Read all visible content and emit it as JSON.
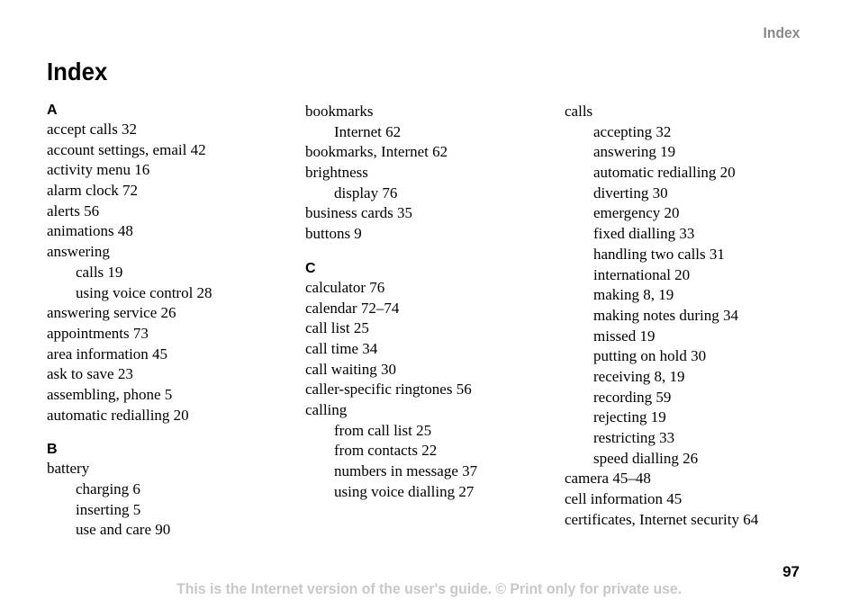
{
  "header": {
    "running_head": "Index",
    "title": "Index"
  },
  "columns": [
    {
      "blocks": [
        {
          "letter": "A",
          "entries": [
            {
              "text": "accept calls 32",
              "level": 0
            },
            {
              "text": "account settings, email 42",
              "level": 0
            },
            {
              "text": "activity menu 16",
              "level": 0
            },
            {
              "text": "alarm clock 72",
              "level": 0
            },
            {
              "text": "alerts 56",
              "level": 0
            },
            {
              "text": "animations 48",
              "level": 0
            },
            {
              "text": "answering",
              "level": 0
            },
            {
              "text": "calls 19",
              "level": 1
            },
            {
              "text": "using voice control 28",
              "level": 1
            },
            {
              "text": "answering service 26",
              "level": 0
            },
            {
              "text": "appointments 73",
              "level": 0
            },
            {
              "text": "area information 45",
              "level": 0
            },
            {
              "text": "ask to save 23",
              "level": 0
            },
            {
              "text": "assembling, phone 5",
              "level": 0
            },
            {
              "text": "automatic redialling 20",
              "level": 0
            }
          ]
        },
        {
          "letter": "B",
          "entries": [
            {
              "text": "battery",
              "level": 0
            },
            {
              "text": "charging 6",
              "level": 1
            },
            {
              "text": "inserting 5",
              "level": 1
            },
            {
              "text": "use and care 90",
              "level": 1
            }
          ]
        }
      ]
    },
    {
      "blocks": [
        {
          "letter": "",
          "entries": [
            {
              "text": "bookmarks",
              "level": 0
            },
            {
              "text": "Internet 62",
              "level": 1
            },
            {
              "text": "bookmarks, Internet 62",
              "level": 0
            },
            {
              "text": "brightness",
              "level": 0
            },
            {
              "text": "display 76",
              "level": 1
            },
            {
              "text": "business cards 35",
              "level": 0
            },
            {
              "text": "buttons 9",
              "level": 0
            }
          ]
        },
        {
          "letter": "C",
          "entries": [
            {
              "text": "calculator 76",
              "level": 0
            },
            {
              "text": "calendar 72–74",
              "level": 0
            },
            {
              "text": "call list 25",
              "level": 0
            },
            {
              "text": "call time 34",
              "level": 0
            },
            {
              "text": "call waiting 30",
              "level": 0
            },
            {
              "text": "caller-specific ringtones 56",
              "level": 0
            },
            {
              "text": "calling",
              "level": 0
            },
            {
              "text": "from call list 25",
              "level": 1
            },
            {
              "text": "from contacts 22",
              "level": 1
            },
            {
              "text": "numbers in message 37",
              "level": 1
            },
            {
              "text": "using voice dialling 27",
              "level": 1
            }
          ]
        }
      ]
    },
    {
      "blocks": [
        {
          "letter": "",
          "entries": [
            {
              "text": "calls",
              "level": 0
            },
            {
              "text": "accepting 32",
              "level": 1
            },
            {
              "text": "answering 19",
              "level": 1
            },
            {
              "text": "automatic redialling 20",
              "level": 1
            },
            {
              "text": "diverting 30",
              "level": 1
            },
            {
              "text": "emergency 20",
              "level": 1
            },
            {
              "text": "fixed dialling 33",
              "level": 1
            },
            {
              "text": "handling two calls 31",
              "level": 1
            },
            {
              "text": "international 20",
              "level": 1
            },
            {
              "text": "making 8, 19",
              "level": 1
            },
            {
              "text": "making notes during 34",
              "level": 1
            },
            {
              "text": "missed 19",
              "level": 1
            },
            {
              "text": "putting on hold 30",
              "level": 1
            },
            {
              "text": "receiving 8, 19",
              "level": 1
            },
            {
              "text": "recording 59",
              "level": 1
            },
            {
              "text": "rejecting 19",
              "level": 1
            },
            {
              "text": "restricting 33",
              "level": 1
            },
            {
              "text": "speed dialling 26",
              "level": 1
            },
            {
              "text": "camera 45–48",
              "level": 0
            },
            {
              "text": "cell information 45",
              "level": 0
            },
            {
              "text": "certificates, Internet security 64",
              "level": 0
            }
          ]
        }
      ]
    }
  ],
  "footer": {
    "page_number": "97",
    "notice": "This is the Internet version of the user's guide. © Print only for private use."
  }
}
